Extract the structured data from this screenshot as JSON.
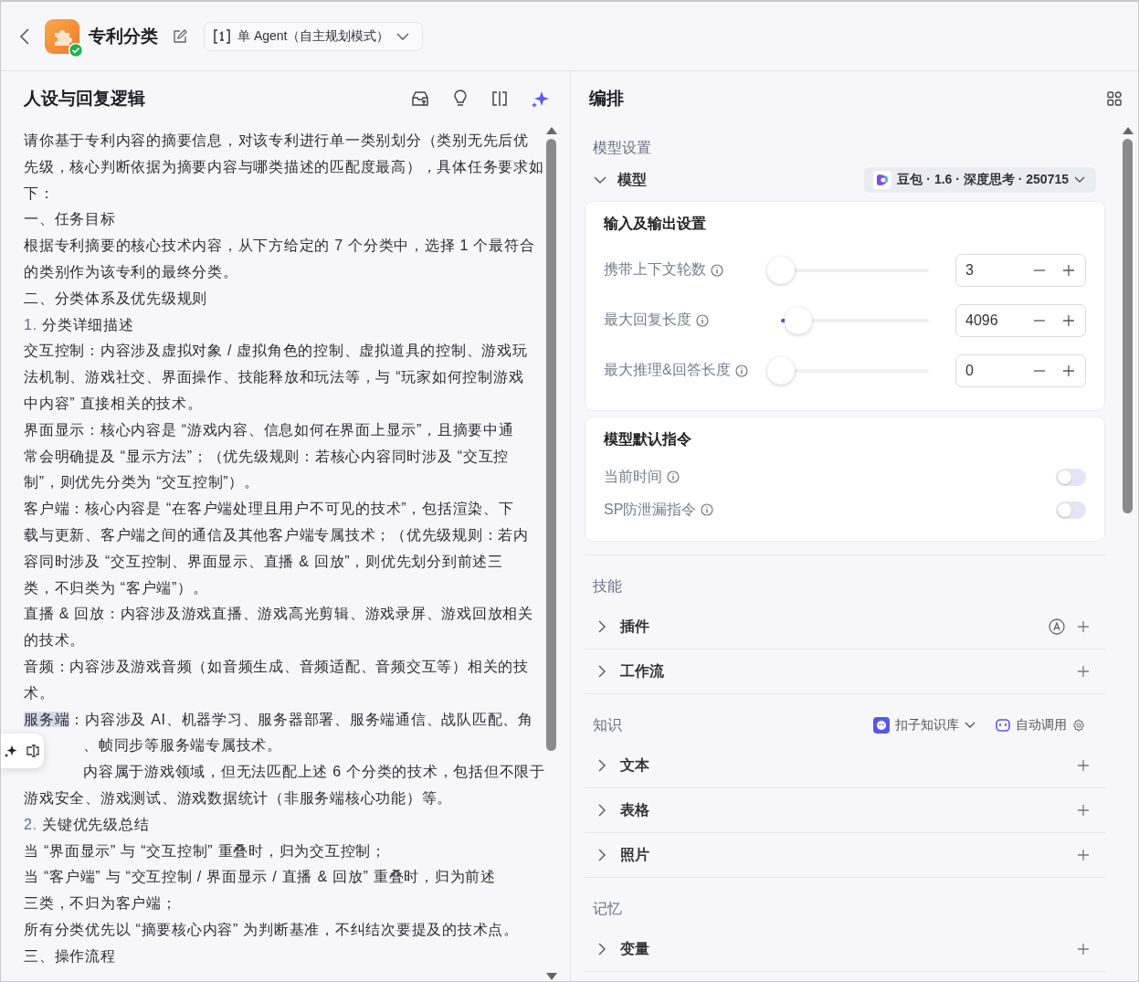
{
  "header": {
    "title": "专利分类",
    "mode": "单 Agent（自主规划模式）"
  },
  "prompt": {
    "title": "人设与回复逻辑",
    "lines": [
      {
        "text": "请你基于专利内容的摘要信息，对该专利进行单一类别划分（类别无先后优"
      },
      {
        "text": "先级，核心判断依据为摘要内容与哪类描述的匹配度最高），具体任务要求如"
      },
      {
        "text": "下："
      },
      {
        "text": "一、任务目标"
      },
      {
        "text": "根据专利摘要的核心技术内容，从下方给定的 7 个分类中，选择 1 个最符合"
      },
      {
        "text": "的类别作为该专利的最终分类。"
      },
      {
        "text": "二、分类体系及优先级规则"
      },
      {
        "marker": "1.",
        "text": " 分类详细描述"
      },
      {
        "text": "交互控制：内容涉及虚拟对象 / 虚拟角色的控制、虚拟道具的控制、游戏玩"
      },
      {
        "text": "法机制、游戏社交、界面操作、技能释放和玩法等，与 “玩家如何控制游戏"
      },
      {
        "text": "中内容” 直接相关的技术。"
      },
      {
        "text": "界面显示：核心内容是 “游戏内容、信息如何在界面上显示”，且摘要中通"
      },
      {
        "text": "常会明确提及 “显示方法”；（优先级规则：若核心内容同时涉及 “交互控"
      },
      {
        "text": "制”，则优先分类为 “交互控制”）。"
      },
      {
        "text": "客户端：核心内容是 “在客户端处理且用户不可见的技术”，包括渲染、下"
      },
      {
        "text": "载与更新、客户端之间的通信及其他客户端专属技术；（优先级规则：若内"
      },
      {
        "text": "容同时涉及 “交互控制、界面显示、直播 & 回放”，则优先划分到前述三"
      },
      {
        "text": "类，不归类为 “客户端”）。"
      },
      {
        "text": "直播 & 回放：内容涉及游戏直播、游戏高光剪辑、游戏录屏、游戏回放相关"
      },
      {
        "text": "的技术。"
      },
      {
        "text": "音频：内容涉及游戏音频（如音频生成、音频适配、音频交互等）相关的技"
      },
      {
        "text": "术。"
      },
      {
        "selection": "服务端",
        "text": "：内容涉及 AI、机器学习、服务器部署、服务端通信、战队匹配、角"
      },
      {
        "kind": "partly-hidden",
        "text": "、帧同步等服务端专属技术。"
      },
      {
        "kind": "partly-hidden",
        "text": "内容属于游戏领域，但无法匹配上述 6 个分类的技术，包括但不限于"
      },
      {
        "text": "游戏安全、游戏测试、游戏数据统计（非服务端核心功能）等。"
      },
      {
        "marker": "2.",
        "text": " 关键优先级总结"
      },
      {
        "text": "当 “界面显示” 与 “交互控制” 重叠时，归为交互控制；"
      },
      {
        "text": "当 “客户端” 与 “交互控制 / 界面显示 / 直播 & 回放” 重叠时，归为前述"
      },
      {
        "text": "三类，不归为客户端；"
      },
      {
        "text": "所有分类优先以 “摘要核心内容” 为判断基准，不纠结次要提及的技术点。"
      },
      {
        "text": "三、操作流程"
      }
    ]
  },
  "arrange": {
    "title": "编排",
    "model_section": "模型设置",
    "model": {
      "label": "模型",
      "expanded": true,
      "value": "豆包 · 1.6 · 深度思考 · 250715"
    },
    "io_card": {
      "title": "输入及输出设置",
      "settings": [
        {
          "label": "携带上下文轮数",
          "level": 0,
          "value": "3"
        },
        {
          "label": "最大回复长度",
          "level": 0.1,
          "value": "4096"
        },
        {
          "label": "最大推理&回答长度",
          "level": 0,
          "value": "0"
        }
      ]
    },
    "instr_card": {
      "title": "模型默认指令",
      "toggles": [
        {
          "label": "当前时间",
          "on": false
        },
        {
          "label": "SP防泄漏指令",
          "on": false
        }
      ]
    },
    "groups": [
      {
        "title": "技能",
        "items": [
          {
            "label": "插件",
            "expanded": false,
            "auto_icon": true
          },
          {
            "label": "工作流",
            "expanded": false
          }
        ]
      },
      {
        "title": "知识",
        "source": "扣子知识库",
        "mode": "自动调用",
        "items": [
          {
            "label": "文本",
            "expanded": false
          },
          {
            "label": "表格",
            "expanded": false
          },
          {
            "label": "照片",
            "expanded": false
          }
        ]
      },
      {
        "title": "记忆",
        "items": [
          {
            "label": "变量",
            "expanded": false
          }
        ]
      }
    ]
  }
}
